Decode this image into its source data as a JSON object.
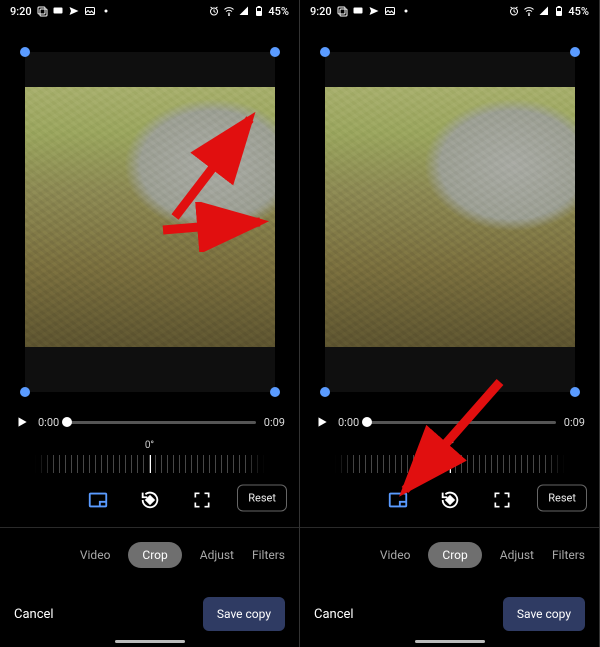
{
  "status": {
    "time": "9:20",
    "battery_text": "45%"
  },
  "video": {
    "current_time": "0:00",
    "duration": "0:09"
  },
  "rotation": {
    "label": "0°"
  },
  "buttons": {
    "reset": "Reset",
    "cancel": "Cancel",
    "save": "Save copy"
  },
  "tabs": {
    "video": "Video",
    "crop": "Crop",
    "adjust": "Adjust",
    "filters": "Filters"
  },
  "icons": {
    "aspect": "aspect-ratio-icon",
    "rotate": "rotate-icon",
    "expand": "expand-icon",
    "play": "play-icon"
  }
}
